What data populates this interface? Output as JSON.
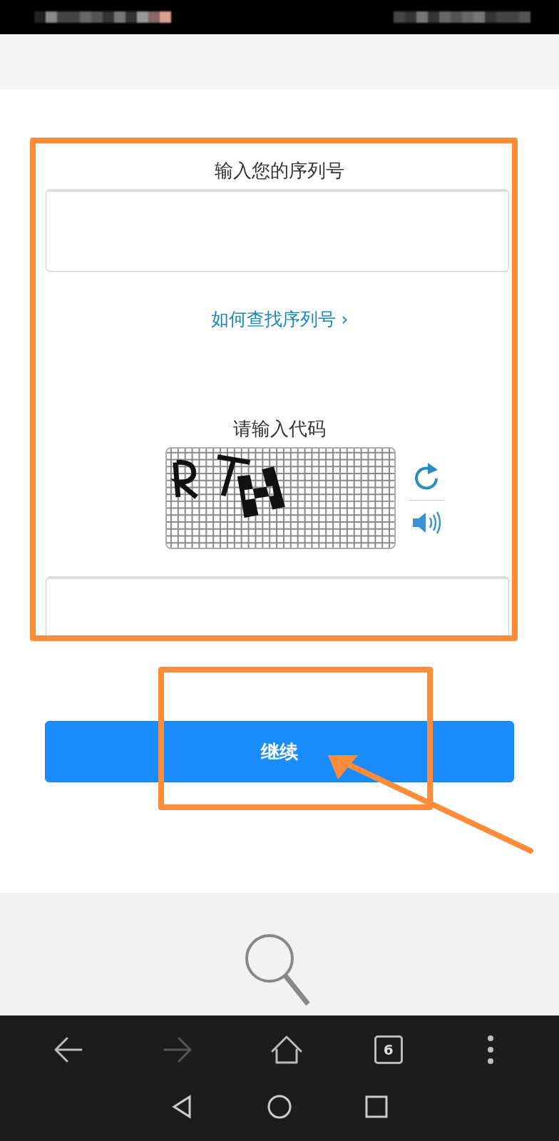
{
  "form": {
    "serial_title": "输入您的序列号",
    "help_link": "如何查找序列号 ›",
    "code_title": "请输入代码",
    "continue_button": "继续"
  },
  "browser_toolbar": [
    {
      "kind": "back",
      "disabled": false
    },
    {
      "kind": "forward",
      "disabled": true
    },
    {
      "kind": "home",
      "disabled": false
    },
    {
      "kind": "tabs",
      "label": "6",
      "disabled": false
    },
    {
      "kind": "menu",
      "disabled": false
    }
  ],
  "system_nav": [
    {
      "kind": "back"
    },
    {
      "kind": "home"
    },
    {
      "kind": "recents"
    }
  ]
}
